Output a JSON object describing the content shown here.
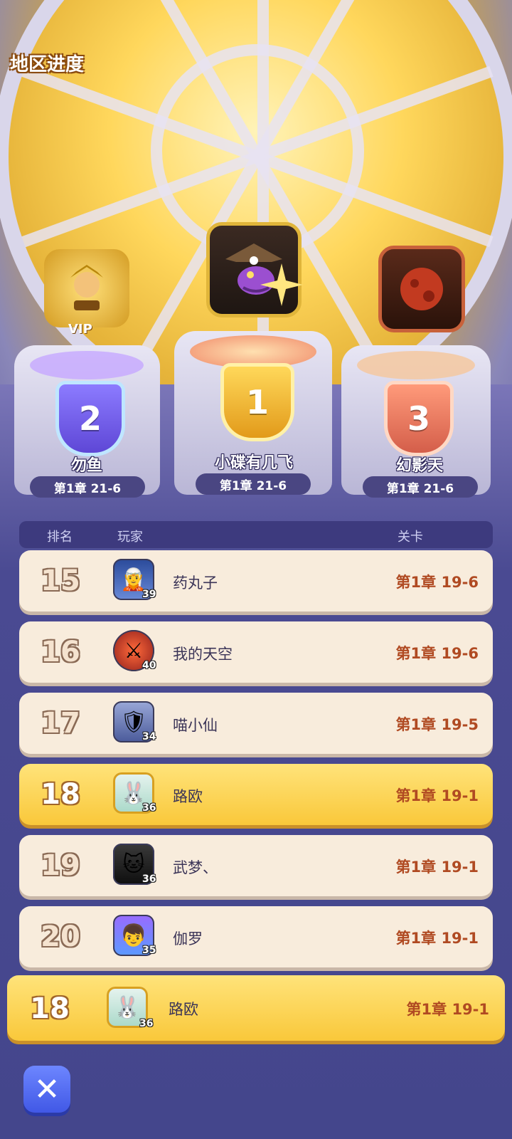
{
  "page_title": "地区进度",
  "podium": [
    {
      "place": "2",
      "name": "勿鱼",
      "stage": "第1章 21-6",
      "avatar_icon": "golden-warrior-vip-avatar-icon",
      "frame_label": "VIP"
    },
    {
      "place": "1",
      "name": "小碟有几飞",
      "stage": "第1章 21-6",
      "avatar_icon": "pirate-captain-avatar-icon"
    },
    {
      "place": "3",
      "name": "幻影天",
      "stage": "第1章 21-6",
      "avatar_icon": "red-moon-avatar-icon"
    }
  ],
  "table": {
    "header_rank": "排名",
    "header_player": "玩家",
    "header_stage": "关卡",
    "rows": [
      {
        "rank": "15",
        "level": "39",
        "name": "药丸子",
        "stage": "第1章 19-6",
        "avatar_icon": "blue-hair-girl-avatar-icon",
        "highlight": false
      },
      {
        "rank": "16",
        "level": "40",
        "name": "我的天空",
        "stage": "第1章 19-6",
        "avatar_icon": "red-knight-avatar-icon",
        "highlight": false
      },
      {
        "rank": "17",
        "level": "34",
        "name": "喵小仙",
        "stage": "第1章 19-5",
        "avatar_icon": "silver-mask-avatar-icon",
        "highlight": false
      },
      {
        "rank": "18",
        "level": "36",
        "name": "路欧",
        "stage": "第1章 19-1",
        "avatar_icon": "white-bunny-avatar-icon",
        "highlight": true
      },
      {
        "rank": "19",
        "level": "36",
        "name": "武梦、",
        "stage": "第1章 19-1",
        "avatar_icon": "black-cat-avatar-icon",
        "highlight": false
      },
      {
        "rank": "20",
        "level": "35",
        "name": "伽罗",
        "stage": "第1章 19-1",
        "avatar_icon": "blonde-boy-avatar-icon",
        "highlight": false
      }
    ]
  },
  "self_row": {
    "rank": "18",
    "level": "36",
    "name": "路欧",
    "stage": "第1章 19-1",
    "avatar_icon": "white-bunny-avatar-icon"
  },
  "close_icon": "close-x-icon"
}
